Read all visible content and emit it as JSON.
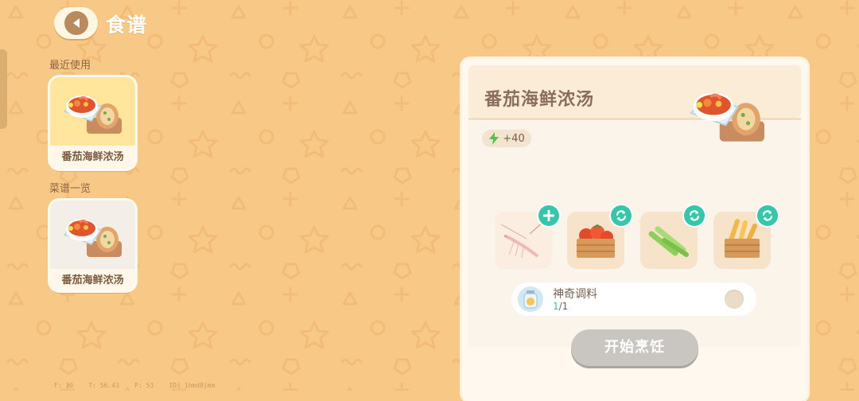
{
  "header": {
    "title": "食谱"
  },
  "sections": {
    "recent": "最近使用",
    "all": "菜谱一览"
  },
  "recent_recipe": {
    "name": "番茄海鲜浓汤"
  },
  "all_recipes": [
    {
      "name": "番茄海鲜浓汤"
    }
  ],
  "detail": {
    "title": "番茄海鲜浓汤",
    "energy": "+40",
    "ingredients": [
      {
        "icon": "shrimp-icon",
        "action": "add"
      },
      {
        "icon": "tomato-crate-icon",
        "action": "swap"
      },
      {
        "icon": "green-onion-icon",
        "action": "swap"
      },
      {
        "icon": "potato-crate-icon",
        "action": "swap"
      }
    ],
    "seasoning": {
      "name": "神奇调料",
      "count_current": "1",
      "count_total": "/1"
    },
    "cook_button": "开始烹饪"
  },
  "debug": "F: 30    T: 56.43    P: 53    ID: 1hmd8jmm",
  "colors": {
    "background": "#f8c986",
    "accent": "#35c7a9",
    "panel": "#fff8ef",
    "disabled_button": "#c9c6c2"
  }
}
